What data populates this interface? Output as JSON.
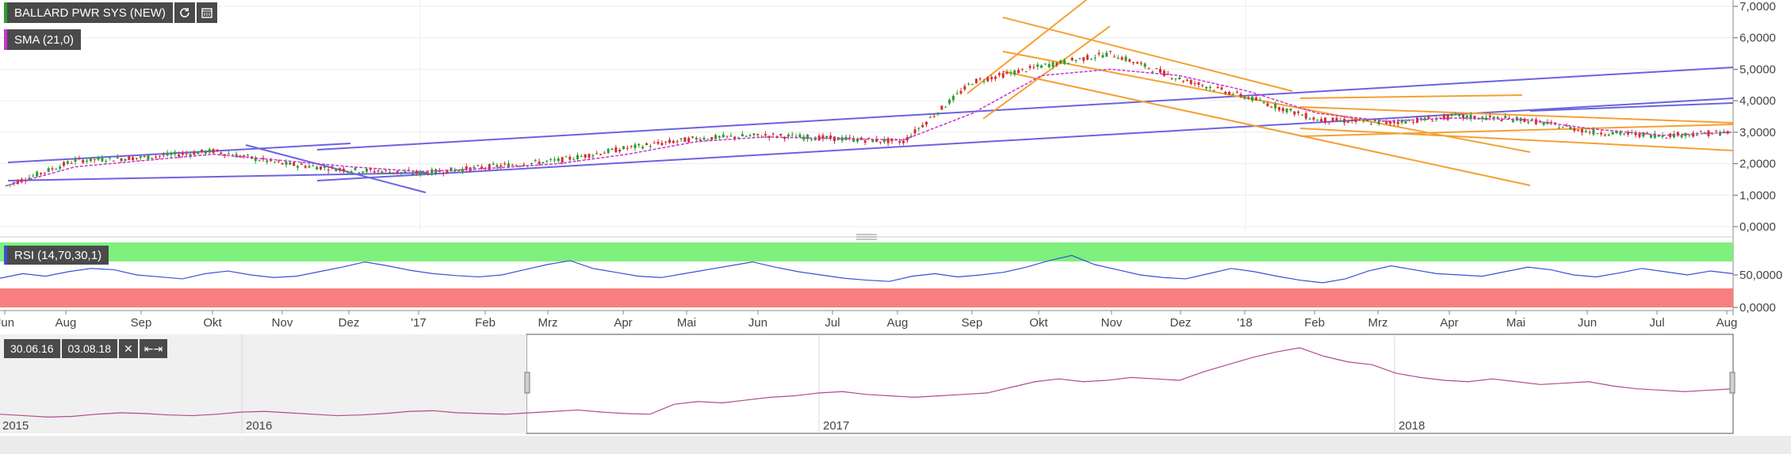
{
  "instrument": {
    "name": "BALLARD PWR SYS (NEW)",
    "color": "#2e7d32"
  },
  "toolbar": {
    "refresh_icon": "refresh-icon",
    "calendar_icon": "calendar-icon"
  },
  "indicators": {
    "sma": {
      "label": "SMA (21,0)",
      "color": "#cc33cc"
    },
    "rsi": {
      "label": "RSI (14,70,30,1)",
      "color": "#3b4fd8",
      "overbought_color": "#7ef07e",
      "oversold_color": "#f77f7f"
    }
  },
  "range": {
    "from": "30.06.16",
    "to": "03.08.18",
    "close_icon": "close-icon",
    "expand_icon": "expand-icon"
  },
  "colors": {
    "up": "#2e9e2e",
    "down": "#d32f2f",
    "trend_blue": "#6b63e0",
    "trend_orange": "#f5a033",
    "navigator": "#b04c8c"
  },
  "chart_data": [
    {
      "type": "candlestick",
      "series": [
        {
          "name": "BALLARD PWR SYS (NEW)",
          "x": [
            "Jul 16",
            "Aug 16",
            "Sep 16",
            "Okt 16",
            "Nov 16",
            "Dez 16",
            "Jan 17",
            "Feb 17",
            "Mrz 17",
            "Apr 17",
            "Mai 17",
            "Jun 17",
            "Jul 17",
            "Aug 17",
            "Sep 17",
            "Okt 17",
            "Nov 17",
            "Dez 17",
            "Jan 18",
            "Feb 18",
            "Mrz 18",
            "Apr 18",
            "Mai 18",
            "Jun 18",
            "Jul 18",
            "Aug 18"
          ],
          "close": [
            1.3,
            2.1,
            2.2,
            2.4,
            2.0,
            1.8,
            1.7,
            1.9,
            2.1,
            2.5,
            2.8,
            2.9,
            2.8,
            2.7,
            4.6,
            5.1,
            5.5,
            4.7,
            4.1,
            3.4,
            3.3,
            3.5,
            3.4,
            3.0,
            2.9,
            3.0
          ]
        },
        {
          "name": "SMA (21,0)",
          "x": [
            "Jul 16",
            "Aug 16",
            "Sep 16",
            "Okt 16",
            "Nov 16",
            "Dez 16",
            "Jan 17",
            "Feb 17",
            "Mrz 17",
            "Apr 17",
            "Mai 17",
            "Jun 17",
            "Jul 17",
            "Aug 17",
            "Sep 17",
            "Okt 17",
            "Nov 17",
            "Dez 17",
            "Jan 18",
            "Feb 18",
            "Mrz 18",
            "Apr 18",
            "Mai 18",
            "Jun 18",
            "Jul 18",
            "Aug 18"
          ],
          "values": [
            1.3,
            1.9,
            2.1,
            2.3,
            2.1,
            1.9,
            1.75,
            1.85,
            2.0,
            2.3,
            2.7,
            2.85,
            2.8,
            2.75,
            3.6,
            4.8,
            5.0,
            4.8,
            4.3,
            3.6,
            3.35,
            3.45,
            3.4,
            3.1,
            2.9,
            3.0
          ]
        }
      ],
      "ylim": [
        0,
        7
      ],
      "y_ticks": [
        "0,0000",
        "1,0000",
        "2,0000",
        "3,0000",
        "4,0000",
        "5,0000",
        "6,0000",
        "7,0000"
      ],
      "x_ticks": [
        "Jun",
        "Aug",
        "Sep",
        "Okt",
        "Nov",
        "Dez",
        "'17",
        "Feb",
        "Mrz",
        "Apr",
        "Mai",
        "Jun",
        "Jul",
        "Aug",
        "Sep",
        "Okt",
        "Nov",
        "Dez",
        "'18",
        "Feb",
        "Mrz",
        "Apr",
        "Mai",
        "Jun",
        "Jul",
        "Aug"
      ],
      "grid": true,
      "trendlines": {
        "blue": 6,
        "orange": 9
      }
    },
    {
      "type": "line",
      "series": [
        {
          "name": "RSI (14,70,30,1)",
          "values": [
            45,
            52,
            48,
            55,
            60,
            58,
            50,
            47,
            44,
            52,
            56,
            50,
            46,
            48,
            55,
            62,
            70,
            64,
            57,
            52,
            49,
            47,
            50,
            58,
            66,
            72,
            60,
            54,
            48,
            46,
            52,
            58,
            64,
            70,
            62,
            55,
            50,
            45,
            42,
            40,
            48,
            52,
            47,
            50,
            54,
            62,
            72,
            80,
            66,
            58,
            50,
            46,
            44,
            52,
            60,
            55,
            48,
            42,
            38,
            44,
            56,
            64,
            58,
            52,
            50,
            48,
            55,
            62,
            58,
            50,
            47,
            53,
            60,
            55,
            50,
            56,
            52
          ]
        }
      ],
      "ylim": [
        0,
        100
      ],
      "y_ticks": [
        "0,0000",
        "50,0000"
      ],
      "bands": {
        "overbought": 70,
        "oversold": 30
      }
    },
    {
      "type": "area",
      "series": [
        {
          "name": "navigator",
          "values": [
            1.3,
            1.2,
            1.1,
            1.15,
            1.3,
            1.4,
            1.35,
            1.25,
            1.2,
            1.3,
            1.45,
            1.5,
            1.4,
            1.3,
            1.2,
            1.25,
            1.35,
            1.5,
            1.55,
            1.4,
            1.35,
            1.3,
            1.4,
            1.5,
            1.6,
            1.45,
            1.35,
            1.3,
            2.0,
            2.2,
            2.1,
            2.3,
            2.5,
            2.6,
            2.8,
            2.9,
            2.7,
            2.6,
            2.5,
            2.6,
            2.7,
            2.8,
            3.2,
            3.6,
            3.8,
            3.6,
            3.7,
            3.9,
            3.8,
            3.7,
            4.3,
            4.8,
            5.3,
            5.7,
            6.0,
            5.4,
            5.0,
            4.8,
            4.2,
            3.9,
            3.7,
            3.6,
            3.8,
            3.6,
            3.4,
            3.5,
            3.6,
            3.3,
            3.1,
            3.0,
            2.9,
            3.0,
            3.1
          ]
        }
      ],
      "x_ticks": [
        "2015",
        "2016",
        "2017",
        "2018"
      ]
    }
  ]
}
